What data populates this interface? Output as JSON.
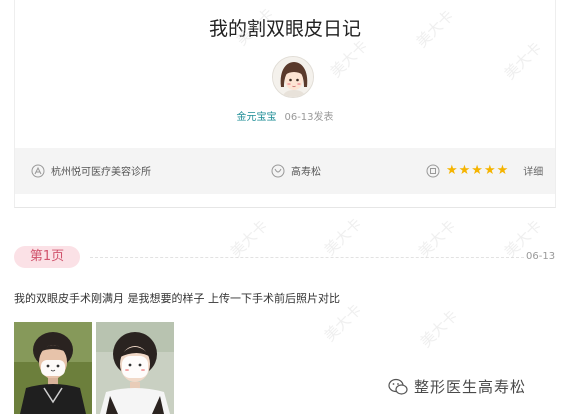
{
  "diary": {
    "title": "我的割双眼皮日记",
    "author": "金元宝宝",
    "publish_date": "06-13发表"
  },
  "info_bar": {
    "hospital": "杭州悦可医疗美容诊所",
    "doctor": "高寿松",
    "rating_stars": "★★★★★",
    "rating_value": 5,
    "detail_label": "详细"
  },
  "entry": {
    "page_label": "第1页",
    "date": "06-13",
    "text": "我的双眼皮手术刚满月 是我想要的样子 上传一下手术前后照片对比"
  },
  "brand": {
    "name": "整形医生高寿松",
    "icon": "wechat-icon"
  },
  "watermark": "美大卡",
  "colors": {
    "author": "#1d8d96",
    "page_tag_bg": "#fbe1e6",
    "page_tag_text": "#d0536c",
    "stars": "#f5b400",
    "info_bar_bg": "#f4f4f4"
  }
}
